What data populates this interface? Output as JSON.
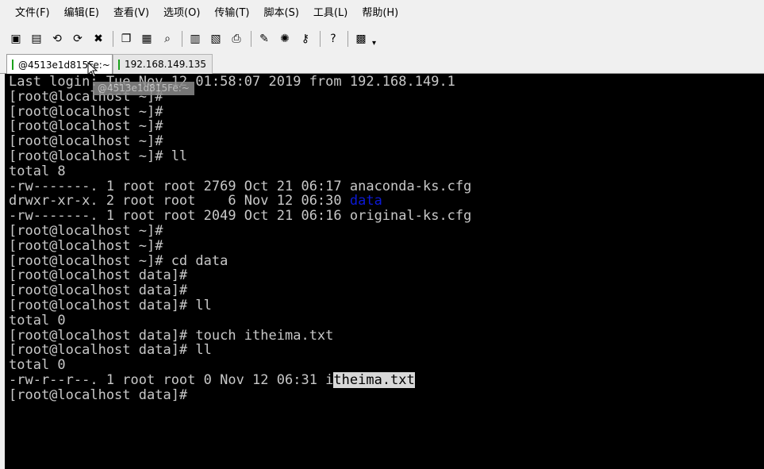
{
  "menu": {
    "items": [
      "文件(F)",
      "编辑(E)",
      "查看(V)",
      "选项(O)",
      "传输(T)",
      "脚本(S)",
      "工具(L)",
      "帮助(H)"
    ]
  },
  "toolbar": {
    "buttons": [
      {
        "icon": "new-session-icon",
        "glyph": "▣"
      },
      {
        "icon": "open-session-icon",
        "glyph": "▤"
      },
      {
        "icon": "reconnect-icon",
        "glyph": "⟲"
      },
      {
        "icon": "reconnect-all-icon",
        "glyph": "⟳"
      },
      {
        "icon": "disconnect-icon",
        "glyph": "✖"
      },
      {
        "icon": "copy-icon",
        "glyph": "❐"
      },
      {
        "icon": "paste-icon",
        "glyph": "▦"
      },
      {
        "icon": "find-icon",
        "glyph": "⌕"
      },
      {
        "icon": "print-setup-icon",
        "glyph": "▥"
      },
      {
        "icon": "print-icon",
        "glyph": "▧"
      },
      {
        "icon": "printer-icon",
        "glyph": "⎙"
      },
      {
        "icon": "session-options-icon",
        "glyph": "✎"
      },
      {
        "icon": "global-options-icon",
        "glyph": "✺"
      },
      {
        "icon": "key-icon",
        "glyph": "⚷"
      },
      {
        "icon": "help-icon",
        "glyph": "?"
      },
      {
        "icon": "keymap-icon",
        "glyph": "▩"
      }
    ],
    "more": "▾"
  },
  "tabs": [
    {
      "label": "@4513e1d815Fe:~",
      "active": true
    },
    {
      "label": "192.168.149.135",
      "active": false
    }
  ],
  "tooltip": "@4513e1d815Fe:~",
  "terminal": {
    "lines": [
      [
        {
          "t": "Last login: Tue Nov 12 01:58:07 2019 from 192.168.149.1"
        }
      ],
      [
        {
          "t": "[root@localhost ~]#"
        }
      ],
      [
        {
          "t": "[root@localhost ~]#"
        }
      ],
      [
        {
          "t": "[root@localhost ~]#"
        }
      ],
      [
        {
          "t": "[root@localhost ~]#"
        }
      ],
      [
        {
          "t": "[root@localhost ~]# ll"
        }
      ],
      [
        {
          "t": "total 8"
        }
      ],
      [
        {
          "t": "-rw-------. 1 root root 2769 Oct 21 06:17 anaconda-ks.cfg"
        }
      ],
      [
        {
          "t": "drwxr-xr-x. 2 root root    6 Nov 12 06:30 "
        },
        {
          "t": "data",
          "style": "blue"
        }
      ],
      [
        {
          "t": "-rw-------. 1 root root 2049 Oct 21 06:16 original-ks.cfg"
        }
      ],
      [
        {
          "t": "[root@localhost ~]#"
        }
      ],
      [
        {
          "t": "[root@localhost ~]#"
        }
      ],
      [
        {
          "t": "[root@localhost ~]# cd data"
        }
      ],
      [
        {
          "t": "[root@localhost data]#"
        }
      ],
      [
        {
          "t": "[root@localhost data]#"
        }
      ],
      [
        {
          "t": "[root@localhost data]# ll"
        }
      ],
      [
        {
          "t": "total 0"
        }
      ],
      [
        {
          "t": "[root@localhost data]# touch itheima.txt"
        }
      ],
      [
        {
          "t": "[root@localhost data]# ll"
        }
      ],
      [
        {
          "t": "total 0"
        }
      ],
      [
        {
          "t": "-rw-r--r--. 1 root root 0 Nov 12 06:31 i"
        },
        {
          "t": "theima.txt",
          "style": "hl"
        }
      ],
      [
        {
          "t": "[root@localhost data]#"
        }
      ]
    ]
  },
  "colors": {
    "terminal_bg": "#000000",
    "terminal_fg": "#c8c8c8",
    "directory": "#0c19d6",
    "selection_bg": "#d8d8d8",
    "tab_marker": "#1aa11a"
  }
}
